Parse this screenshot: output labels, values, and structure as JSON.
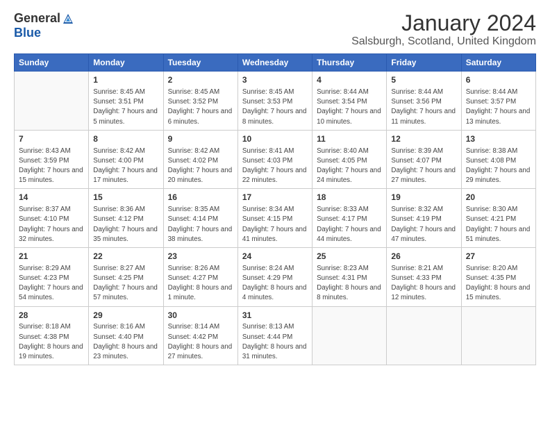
{
  "logo": {
    "general": "General",
    "blue": "Blue"
  },
  "title": "January 2024",
  "location": "Salsburgh, Scotland, United Kingdom",
  "days_of_week": [
    "Sunday",
    "Monday",
    "Tuesday",
    "Wednesday",
    "Thursday",
    "Friday",
    "Saturday"
  ],
  "weeks": [
    [
      {
        "date": "",
        "sunrise": "",
        "sunset": "",
        "daylight": ""
      },
      {
        "date": "1",
        "sunrise": "Sunrise: 8:45 AM",
        "sunset": "Sunset: 3:51 PM",
        "daylight": "Daylight: 7 hours and 5 minutes."
      },
      {
        "date": "2",
        "sunrise": "Sunrise: 8:45 AM",
        "sunset": "Sunset: 3:52 PM",
        "daylight": "Daylight: 7 hours and 6 minutes."
      },
      {
        "date": "3",
        "sunrise": "Sunrise: 8:45 AM",
        "sunset": "Sunset: 3:53 PM",
        "daylight": "Daylight: 7 hours and 8 minutes."
      },
      {
        "date": "4",
        "sunrise": "Sunrise: 8:44 AM",
        "sunset": "Sunset: 3:54 PM",
        "daylight": "Daylight: 7 hours and 10 minutes."
      },
      {
        "date": "5",
        "sunrise": "Sunrise: 8:44 AM",
        "sunset": "Sunset: 3:56 PM",
        "daylight": "Daylight: 7 hours and 11 minutes."
      },
      {
        "date": "6",
        "sunrise": "Sunrise: 8:44 AM",
        "sunset": "Sunset: 3:57 PM",
        "daylight": "Daylight: 7 hours and 13 minutes."
      }
    ],
    [
      {
        "date": "7",
        "sunrise": "Sunrise: 8:43 AM",
        "sunset": "Sunset: 3:59 PM",
        "daylight": "Daylight: 7 hours and 15 minutes."
      },
      {
        "date": "8",
        "sunrise": "Sunrise: 8:42 AM",
        "sunset": "Sunset: 4:00 PM",
        "daylight": "Daylight: 7 hours and 17 minutes."
      },
      {
        "date": "9",
        "sunrise": "Sunrise: 8:42 AM",
        "sunset": "Sunset: 4:02 PM",
        "daylight": "Daylight: 7 hours and 20 minutes."
      },
      {
        "date": "10",
        "sunrise": "Sunrise: 8:41 AM",
        "sunset": "Sunset: 4:03 PM",
        "daylight": "Daylight: 7 hours and 22 minutes."
      },
      {
        "date": "11",
        "sunrise": "Sunrise: 8:40 AM",
        "sunset": "Sunset: 4:05 PM",
        "daylight": "Daylight: 7 hours and 24 minutes."
      },
      {
        "date": "12",
        "sunrise": "Sunrise: 8:39 AM",
        "sunset": "Sunset: 4:07 PM",
        "daylight": "Daylight: 7 hours and 27 minutes."
      },
      {
        "date": "13",
        "sunrise": "Sunrise: 8:38 AM",
        "sunset": "Sunset: 4:08 PM",
        "daylight": "Daylight: 7 hours and 29 minutes."
      }
    ],
    [
      {
        "date": "14",
        "sunrise": "Sunrise: 8:37 AM",
        "sunset": "Sunset: 4:10 PM",
        "daylight": "Daylight: 7 hours and 32 minutes."
      },
      {
        "date": "15",
        "sunrise": "Sunrise: 8:36 AM",
        "sunset": "Sunset: 4:12 PM",
        "daylight": "Daylight: 7 hours and 35 minutes."
      },
      {
        "date": "16",
        "sunrise": "Sunrise: 8:35 AM",
        "sunset": "Sunset: 4:14 PM",
        "daylight": "Daylight: 7 hours and 38 minutes."
      },
      {
        "date": "17",
        "sunrise": "Sunrise: 8:34 AM",
        "sunset": "Sunset: 4:15 PM",
        "daylight": "Daylight: 7 hours and 41 minutes."
      },
      {
        "date": "18",
        "sunrise": "Sunrise: 8:33 AM",
        "sunset": "Sunset: 4:17 PM",
        "daylight": "Daylight: 7 hours and 44 minutes."
      },
      {
        "date": "19",
        "sunrise": "Sunrise: 8:32 AM",
        "sunset": "Sunset: 4:19 PM",
        "daylight": "Daylight: 7 hours and 47 minutes."
      },
      {
        "date": "20",
        "sunrise": "Sunrise: 8:30 AM",
        "sunset": "Sunset: 4:21 PM",
        "daylight": "Daylight: 7 hours and 51 minutes."
      }
    ],
    [
      {
        "date": "21",
        "sunrise": "Sunrise: 8:29 AM",
        "sunset": "Sunset: 4:23 PM",
        "daylight": "Daylight: 7 hours and 54 minutes."
      },
      {
        "date": "22",
        "sunrise": "Sunrise: 8:27 AM",
        "sunset": "Sunset: 4:25 PM",
        "daylight": "Daylight: 7 hours and 57 minutes."
      },
      {
        "date": "23",
        "sunrise": "Sunrise: 8:26 AM",
        "sunset": "Sunset: 4:27 PM",
        "daylight": "Daylight: 8 hours and 1 minute."
      },
      {
        "date": "24",
        "sunrise": "Sunrise: 8:24 AM",
        "sunset": "Sunset: 4:29 PM",
        "daylight": "Daylight: 8 hours and 4 minutes."
      },
      {
        "date": "25",
        "sunrise": "Sunrise: 8:23 AM",
        "sunset": "Sunset: 4:31 PM",
        "daylight": "Daylight: 8 hours and 8 minutes."
      },
      {
        "date": "26",
        "sunrise": "Sunrise: 8:21 AM",
        "sunset": "Sunset: 4:33 PM",
        "daylight": "Daylight: 8 hours and 12 minutes."
      },
      {
        "date": "27",
        "sunrise": "Sunrise: 8:20 AM",
        "sunset": "Sunset: 4:35 PM",
        "daylight": "Daylight: 8 hours and 15 minutes."
      }
    ],
    [
      {
        "date": "28",
        "sunrise": "Sunrise: 8:18 AM",
        "sunset": "Sunset: 4:38 PM",
        "daylight": "Daylight: 8 hours and 19 minutes."
      },
      {
        "date": "29",
        "sunrise": "Sunrise: 8:16 AM",
        "sunset": "Sunset: 4:40 PM",
        "daylight": "Daylight: 8 hours and 23 minutes."
      },
      {
        "date": "30",
        "sunrise": "Sunrise: 8:14 AM",
        "sunset": "Sunset: 4:42 PM",
        "daylight": "Daylight: 8 hours and 27 minutes."
      },
      {
        "date": "31",
        "sunrise": "Sunrise: 8:13 AM",
        "sunset": "Sunset: 4:44 PM",
        "daylight": "Daylight: 8 hours and 31 minutes."
      },
      {
        "date": "",
        "sunrise": "",
        "sunset": "",
        "daylight": ""
      },
      {
        "date": "",
        "sunrise": "",
        "sunset": "",
        "daylight": ""
      },
      {
        "date": "",
        "sunrise": "",
        "sunset": "",
        "daylight": ""
      }
    ]
  ]
}
